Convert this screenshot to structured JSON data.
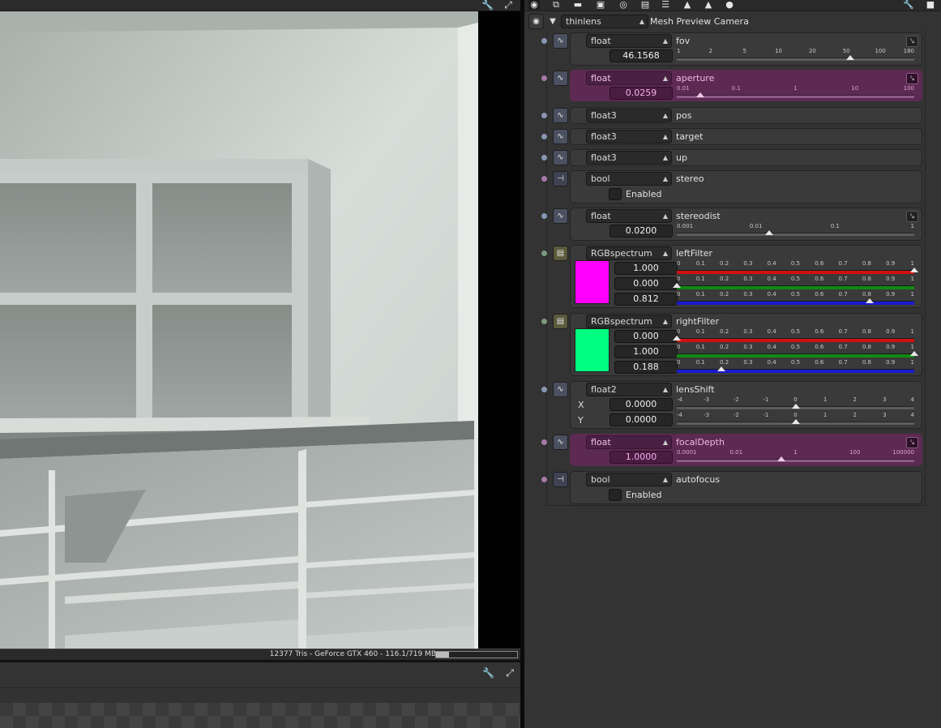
{
  "viewport": {
    "status_text": "12377 Tris - GeForce GTX 460 - 116.1/719 MB",
    "memory_used_fraction": 0.16,
    "toolbar_icons": [
      "wrench-icon",
      "fullscreen-icon"
    ],
    "bottom_toolbar_icons": [
      "wrench-icon",
      "fullscreen-icon"
    ]
  },
  "panel": {
    "toolbar_icons": [
      "camera-icon",
      "copy-icon",
      "minus-icon",
      "image-icon",
      "film-icon",
      "bar-icon",
      "layers-icon",
      "mountain-icon",
      "expand-icon",
      "render-icon",
      "wrench-icon",
      "pin-icon"
    ],
    "camera_type": "thinlens",
    "camera_name": "Mesh Preview Camera"
  },
  "params": {
    "fov": {
      "type": "float",
      "name": "fov",
      "value": "46.1568",
      "ticks": [
        "1",
        "2",
        "5",
        "10",
        "20",
        "50",
        "100",
        "180"
      ],
      "slider_fraction": 0.73
    },
    "aperture": {
      "type": "float",
      "name": "aperture",
      "value": "0.0259",
      "ticks": [
        "0.01",
        "0.1",
        "1",
        "10",
        "100"
      ],
      "slider_fraction": 0.1
    },
    "pos": {
      "type": "float3",
      "name": "pos"
    },
    "target": {
      "type": "float3",
      "name": "target"
    },
    "up": {
      "type": "float3",
      "name": "up"
    },
    "stereo": {
      "type": "bool",
      "name": "stereo",
      "checkbox_label": "Enabled",
      "checked": false
    },
    "stereodist": {
      "type": "float",
      "name": "stereodist",
      "value": "0.0200",
      "ticks": [
        "0.001",
        "0.01",
        "0.1",
        "1"
      ],
      "slider_fraction": 0.39
    },
    "leftFilter": {
      "type": "RGBspectrum",
      "name": "leftFilter",
      "swatch_color": "#ff00ff",
      "ticks": [
        "0",
        "0.1",
        "0.2",
        "0.3",
        "0.4",
        "0.5",
        "0.6",
        "0.7",
        "0.8",
        "0.9",
        "1"
      ],
      "channels": [
        {
          "value": "1.000",
          "color": "#d11010",
          "fraction": 1.0
        },
        {
          "value": "0.000",
          "color": "#108a10",
          "fraction": 0.0
        },
        {
          "value": "0.812",
          "color": "#1a1ad0",
          "fraction": 0.812
        }
      ]
    },
    "rightFilter": {
      "type": "RGBspectrum",
      "name": "rightFilter",
      "swatch_color": "#00ff80",
      "ticks": [
        "0",
        "0.1",
        "0.2",
        "0.3",
        "0.4",
        "0.5",
        "0.6",
        "0.7",
        "0.8",
        "0.9",
        "1"
      ],
      "channels": [
        {
          "value": "0.000",
          "color": "#d11010",
          "fraction": 0.0
        },
        {
          "value": "1.000",
          "color": "#108a10",
          "fraction": 1.0
        },
        {
          "value": "0.188",
          "color": "#1a1ad0",
          "fraction": 0.188
        }
      ]
    },
    "lensShift": {
      "type": "float2",
      "name": "lensShift",
      "ticks": [
        "-4",
        "-3",
        "-2",
        "-1",
        "0",
        "1",
        "2",
        "3",
        "4"
      ],
      "axes": [
        {
          "label": "X",
          "value": "0.0000",
          "fraction": 0.5
        },
        {
          "label": "Y",
          "value": "0.0000",
          "fraction": 0.5
        }
      ]
    },
    "focalDepth": {
      "type": "float",
      "name": "focalDepth",
      "value": "1.0000",
      "ticks": [
        "0.0001",
        "0.01",
        "1",
        "100",
        "100000"
      ],
      "slider_fraction": 0.44
    },
    "autofocus": {
      "type": "bool",
      "name": "autofocus",
      "checkbox_label": "Enabled",
      "checked": false
    }
  }
}
